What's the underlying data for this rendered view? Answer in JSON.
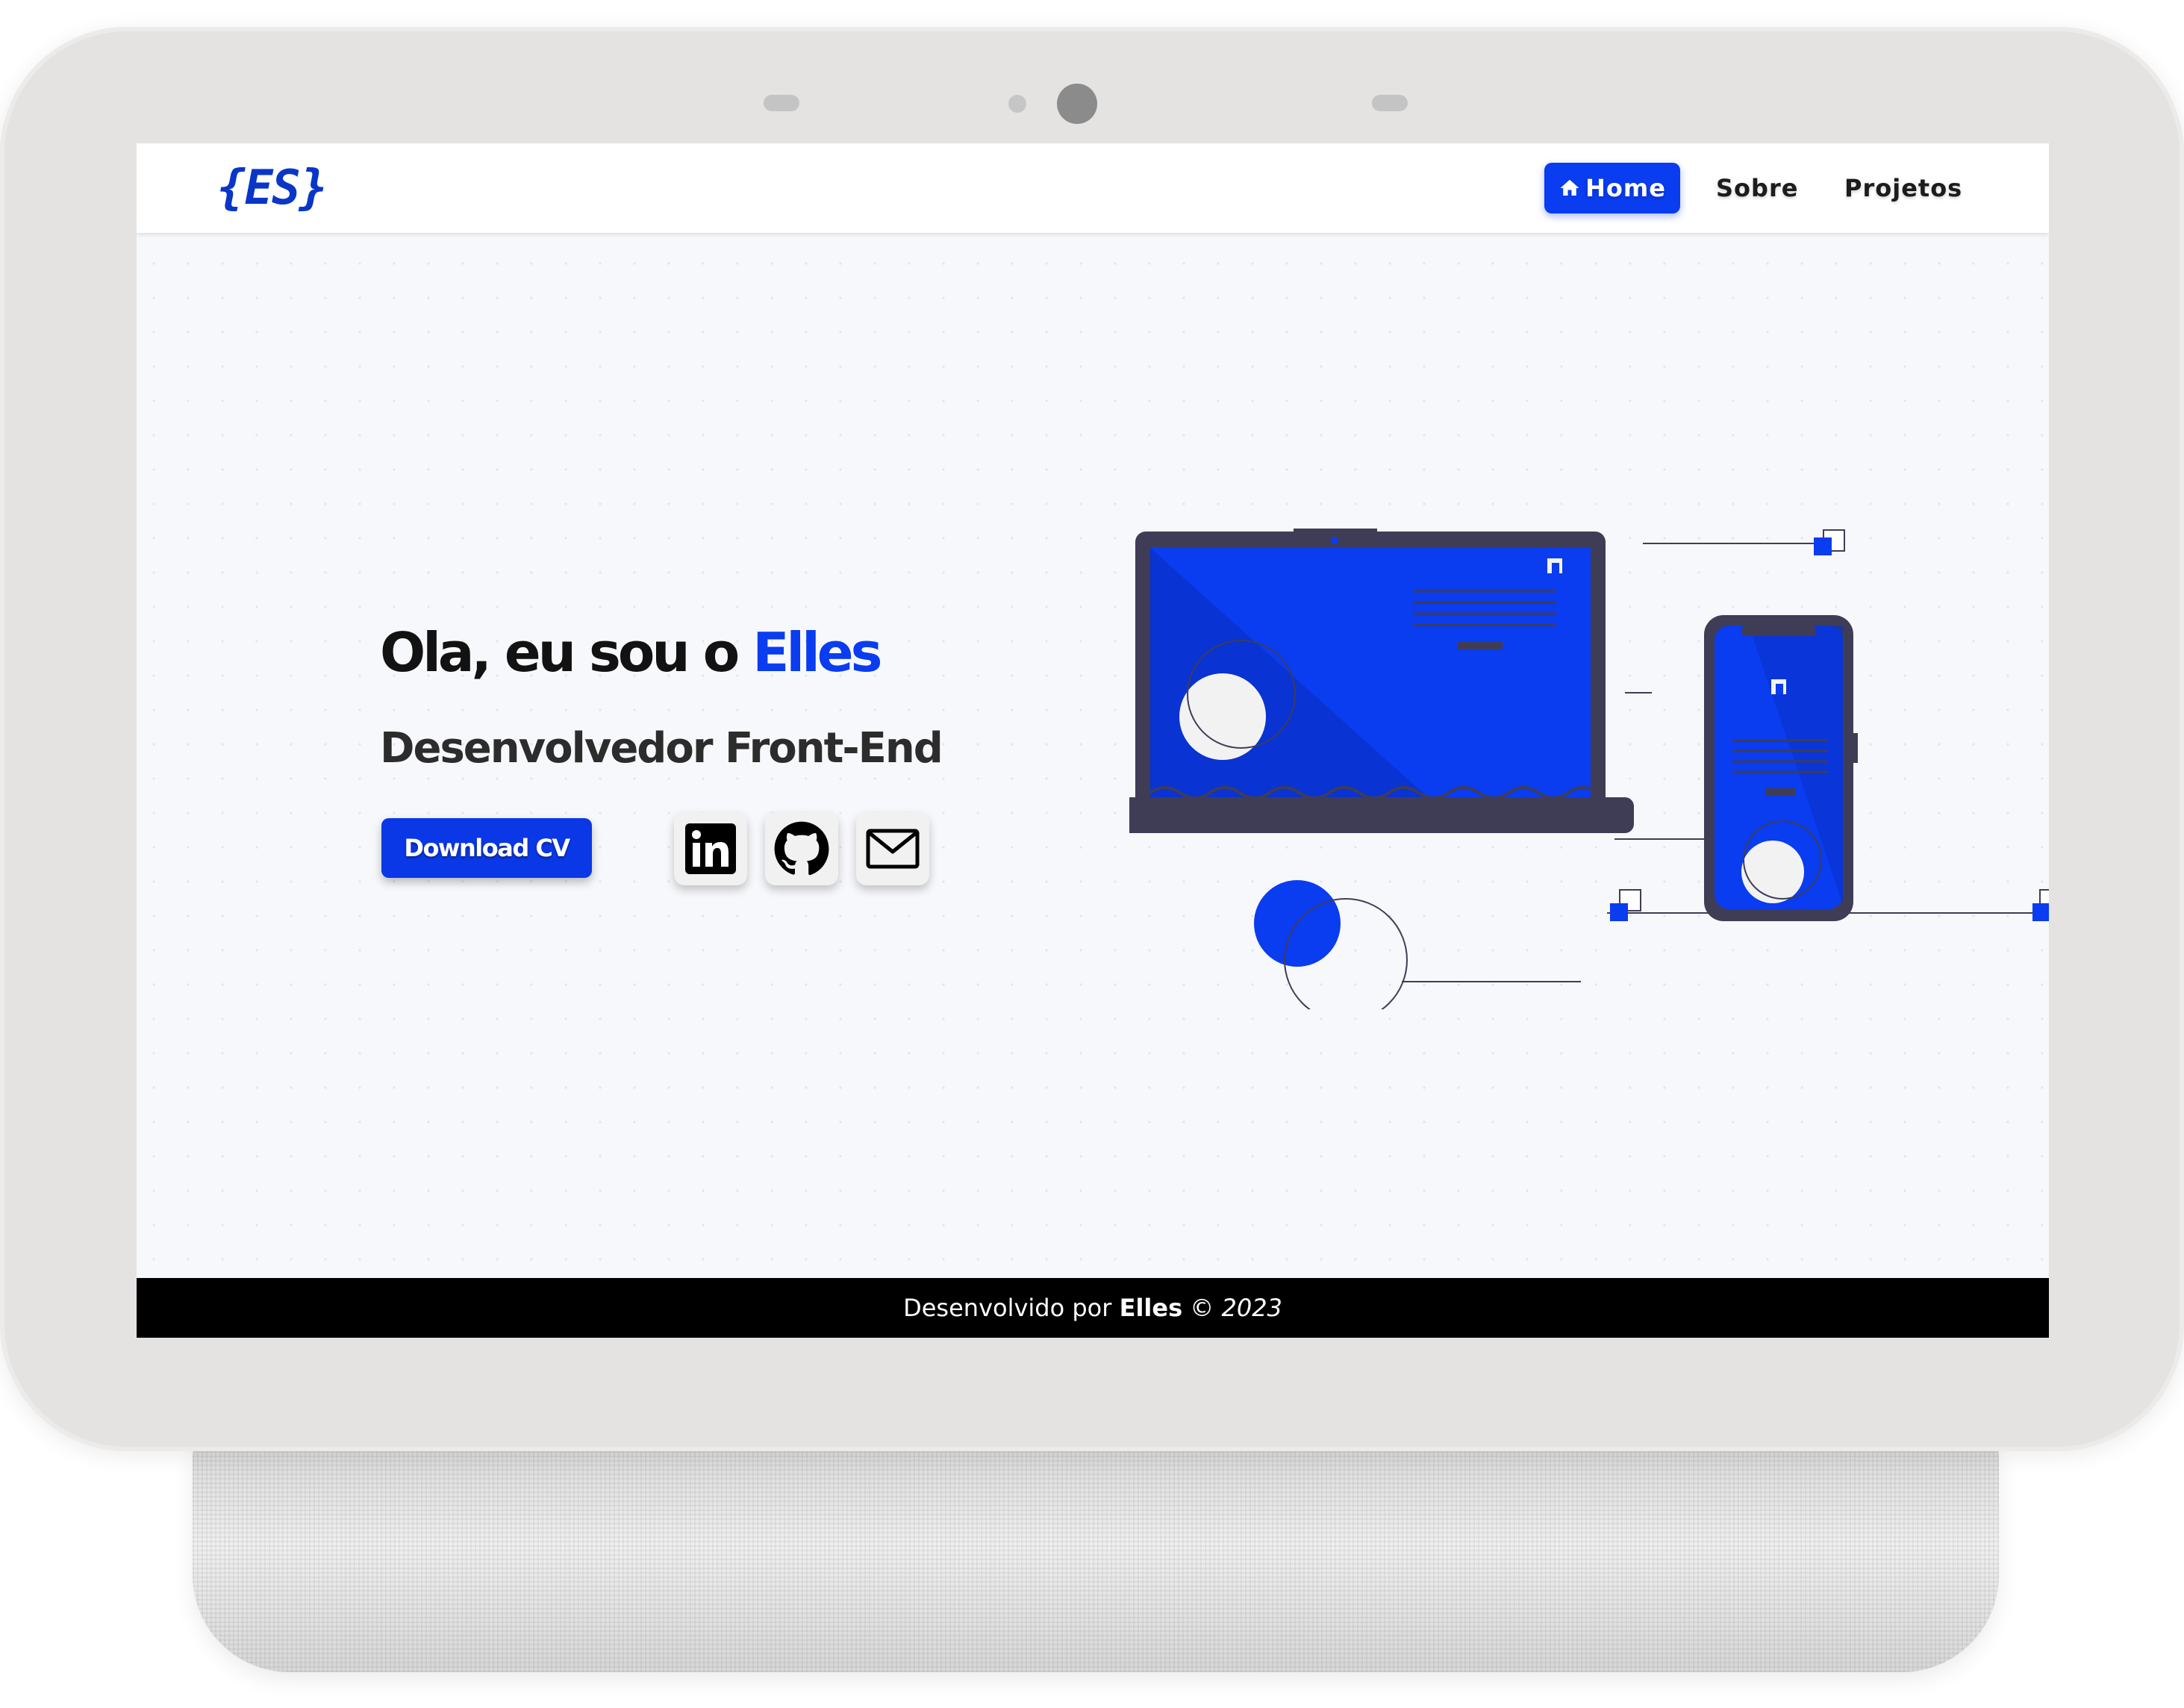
{
  "navbar": {
    "logo": "{ES}",
    "items": [
      {
        "label": "Home",
        "icon": "home-icon",
        "active": true
      },
      {
        "label": "Sobre"
      },
      {
        "label": "Projetos"
      }
    ]
  },
  "hero": {
    "greeting": "Ola, eu sou o ",
    "name": "Elles",
    "subtitle": "Desenvolvedor Front-End",
    "download_label": "Download CV",
    "social": [
      "linkedin-icon",
      "github-icon",
      "email-icon"
    ]
  },
  "footer": {
    "prefix": "Desenvolvido por ",
    "author": "Elles",
    "suffix": " © 2023"
  },
  "colors": {
    "accent": "#0a3cf0",
    "text": "#121212",
    "footer_bg": "#000000",
    "screen_bg": "#f7f8fb"
  }
}
